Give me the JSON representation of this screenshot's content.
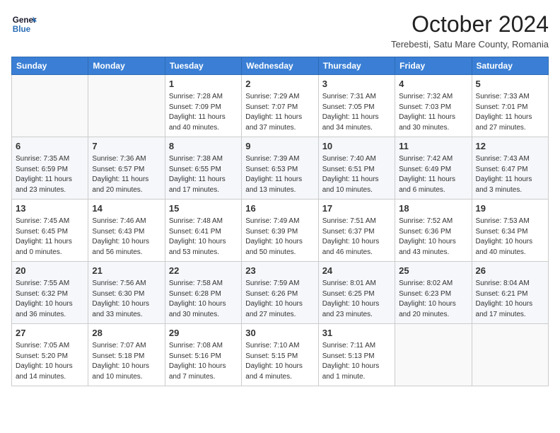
{
  "header": {
    "logo_line1": "General",
    "logo_line2": "Blue",
    "month_title": "October 2024",
    "location": "Terebesti, Satu Mare County, Romania"
  },
  "days_of_week": [
    "Sunday",
    "Monday",
    "Tuesday",
    "Wednesday",
    "Thursday",
    "Friday",
    "Saturday"
  ],
  "weeks": [
    [
      {
        "day": "",
        "info": ""
      },
      {
        "day": "",
        "info": ""
      },
      {
        "day": "1",
        "info": "Sunrise: 7:28 AM\nSunset: 7:09 PM\nDaylight: 11 hours and 40 minutes."
      },
      {
        "day": "2",
        "info": "Sunrise: 7:29 AM\nSunset: 7:07 PM\nDaylight: 11 hours and 37 minutes."
      },
      {
        "day": "3",
        "info": "Sunrise: 7:31 AM\nSunset: 7:05 PM\nDaylight: 11 hours and 34 minutes."
      },
      {
        "day": "4",
        "info": "Sunrise: 7:32 AM\nSunset: 7:03 PM\nDaylight: 11 hours and 30 minutes."
      },
      {
        "day": "5",
        "info": "Sunrise: 7:33 AM\nSunset: 7:01 PM\nDaylight: 11 hours and 27 minutes."
      }
    ],
    [
      {
        "day": "6",
        "info": "Sunrise: 7:35 AM\nSunset: 6:59 PM\nDaylight: 11 hours and 23 minutes."
      },
      {
        "day": "7",
        "info": "Sunrise: 7:36 AM\nSunset: 6:57 PM\nDaylight: 11 hours and 20 minutes."
      },
      {
        "day": "8",
        "info": "Sunrise: 7:38 AM\nSunset: 6:55 PM\nDaylight: 11 hours and 17 minutes."
      },
      {
        "day": "9",
        "info": "Sunrise: 7:39 AM\nSunset: 6:53 PM\nDaylight: 11 hours and 13 minutes."
      },
      {
        "day": "10",
        "info": "Sunrise: 7:40 AM\nSunset: 6:51 PM\nDaylight: 11 hours and 10 minutes."
      },
      {
        "day": "11",
        "info": "Sunrise: 7:42 AM\nSunset: 6:49 PM\nDaylight: 11 hours and 6 minutes."
      },
      {
        "day": "12",
        "info": "Sunrise: 7:43 AM\nSunset: 6:47 PM\nDaylight: 11 hours and 3 minutes."
      }
    ],
    [
      {
        "day": "13",
        "info": "Sunrise: 7:45 AM\nSunset: 6:45 PM\nDaylight: 11 hours and 0 minutes."
      },
      {
        "day": "14",
        "info": "Sunrise: 7:46 AM\nSunset: 6:43 PM\nDaylight: 10 hours and 56 minutes."
      },
      {
        "day": "15",
        "info": "Sunrise: 7:48 AM\nSunset: 6:41 PM\nDaylight: 10 hours and 53 minutes."
      },
      {
        "day": "16",
        "info": "Sunrise: 7:49 AM\nSunset: 6:39 PM\nDaylight: 10 hours and 50 minutes."
      },
      {
        "day": "17",
        "info": "Sunrise: 7:51 AM\nSunset: 6:37 PM\nDaylight: 10 hours and 46 minutes."
      },
      {
        "day": "18",
        "info": "Sunrise: 7:52 AM\nSunset: 6:36 PM\nDaylight: 10 hours and 43 minutes."
      },
      {
        "day": "19",
        "info": "Sunrise: 7:53 AM\nSunset: 6:34 PM\nDaylight: 10 hours and 40 minutes."
      }
    ],
    [
      {
        "day": "20",
        "info": "Sunrise: 7:55 AM\nSunset: 6:32 PM\nDaylight: 10 hours and 36 minutes."
      },
      {
        "day": "21",
        "info": "Sunrise: 7:56 AM\nSunset: 6:30 PM\nDaylight: 10 hours and 33 minutes."
      },
      {
        "day": "22",
        "info": "Sunrise: 7:58 AM\nSunset: 6:28 PM\nDaylight: 10 hours and 30 minutes."
      },
      {
        "day": "23",
        "info": "Sunrise: 7:59 AM\nSunset: 6:26 PM\nDaylight: 10 hours and 27 minutes."
      },
      {
        "day": "24",
        "info": "Sunrise: 8:01 AM\nSunset: 6:25 PM\nDaylight: 10 hours and 23 minutes."
      },
      {
        "day": "25",
        "info": "Sunrise: 8:02 AM\nSunset: 6:23 PM\nDaylight: 10 hours and 20 minutes."
      },
      {
        "day": "26",
        "info": "Sunrise: 8:04 AM\nSunset: 6:21 PM\nDaylight: 10 hours and 17 minutes."
      }
    ],
    [
      {
        "day": "27",
        "info": "Sunrise: 7:05 AM\nSunset: 5:20 PM\nDaylight: 10 hours and 14 minutes."
      },
      {
        "day": "28",
        "info": "Sunrise: 7:07 AM\nSunset: 5:18 PM\nDaylight: 10 hours and 10 minutes."
      },
      {
        "day": "29",
        "info": "Sunrise: 7:08 AM\nSunset: 5:16 PM\nDaylight: 10 hours and 7 minutes."
      },
      {
        "day": "30",
        "info": "Sunrise: 7:10 AM\nSunset: 5:15 PM\nDaylight: 10 hours and 4 minutes."
      },
      {
        "day": "31",
        "info": "Sunrise: 7:11 AM\nSunset: 5:13 PM\nDaylight: 10 hours and 1 minute."
      },
      {
        "day": "",
        "info": ""
      },
      {
        "day": "",
        "info": ""
      }
    ]
  ]
}
